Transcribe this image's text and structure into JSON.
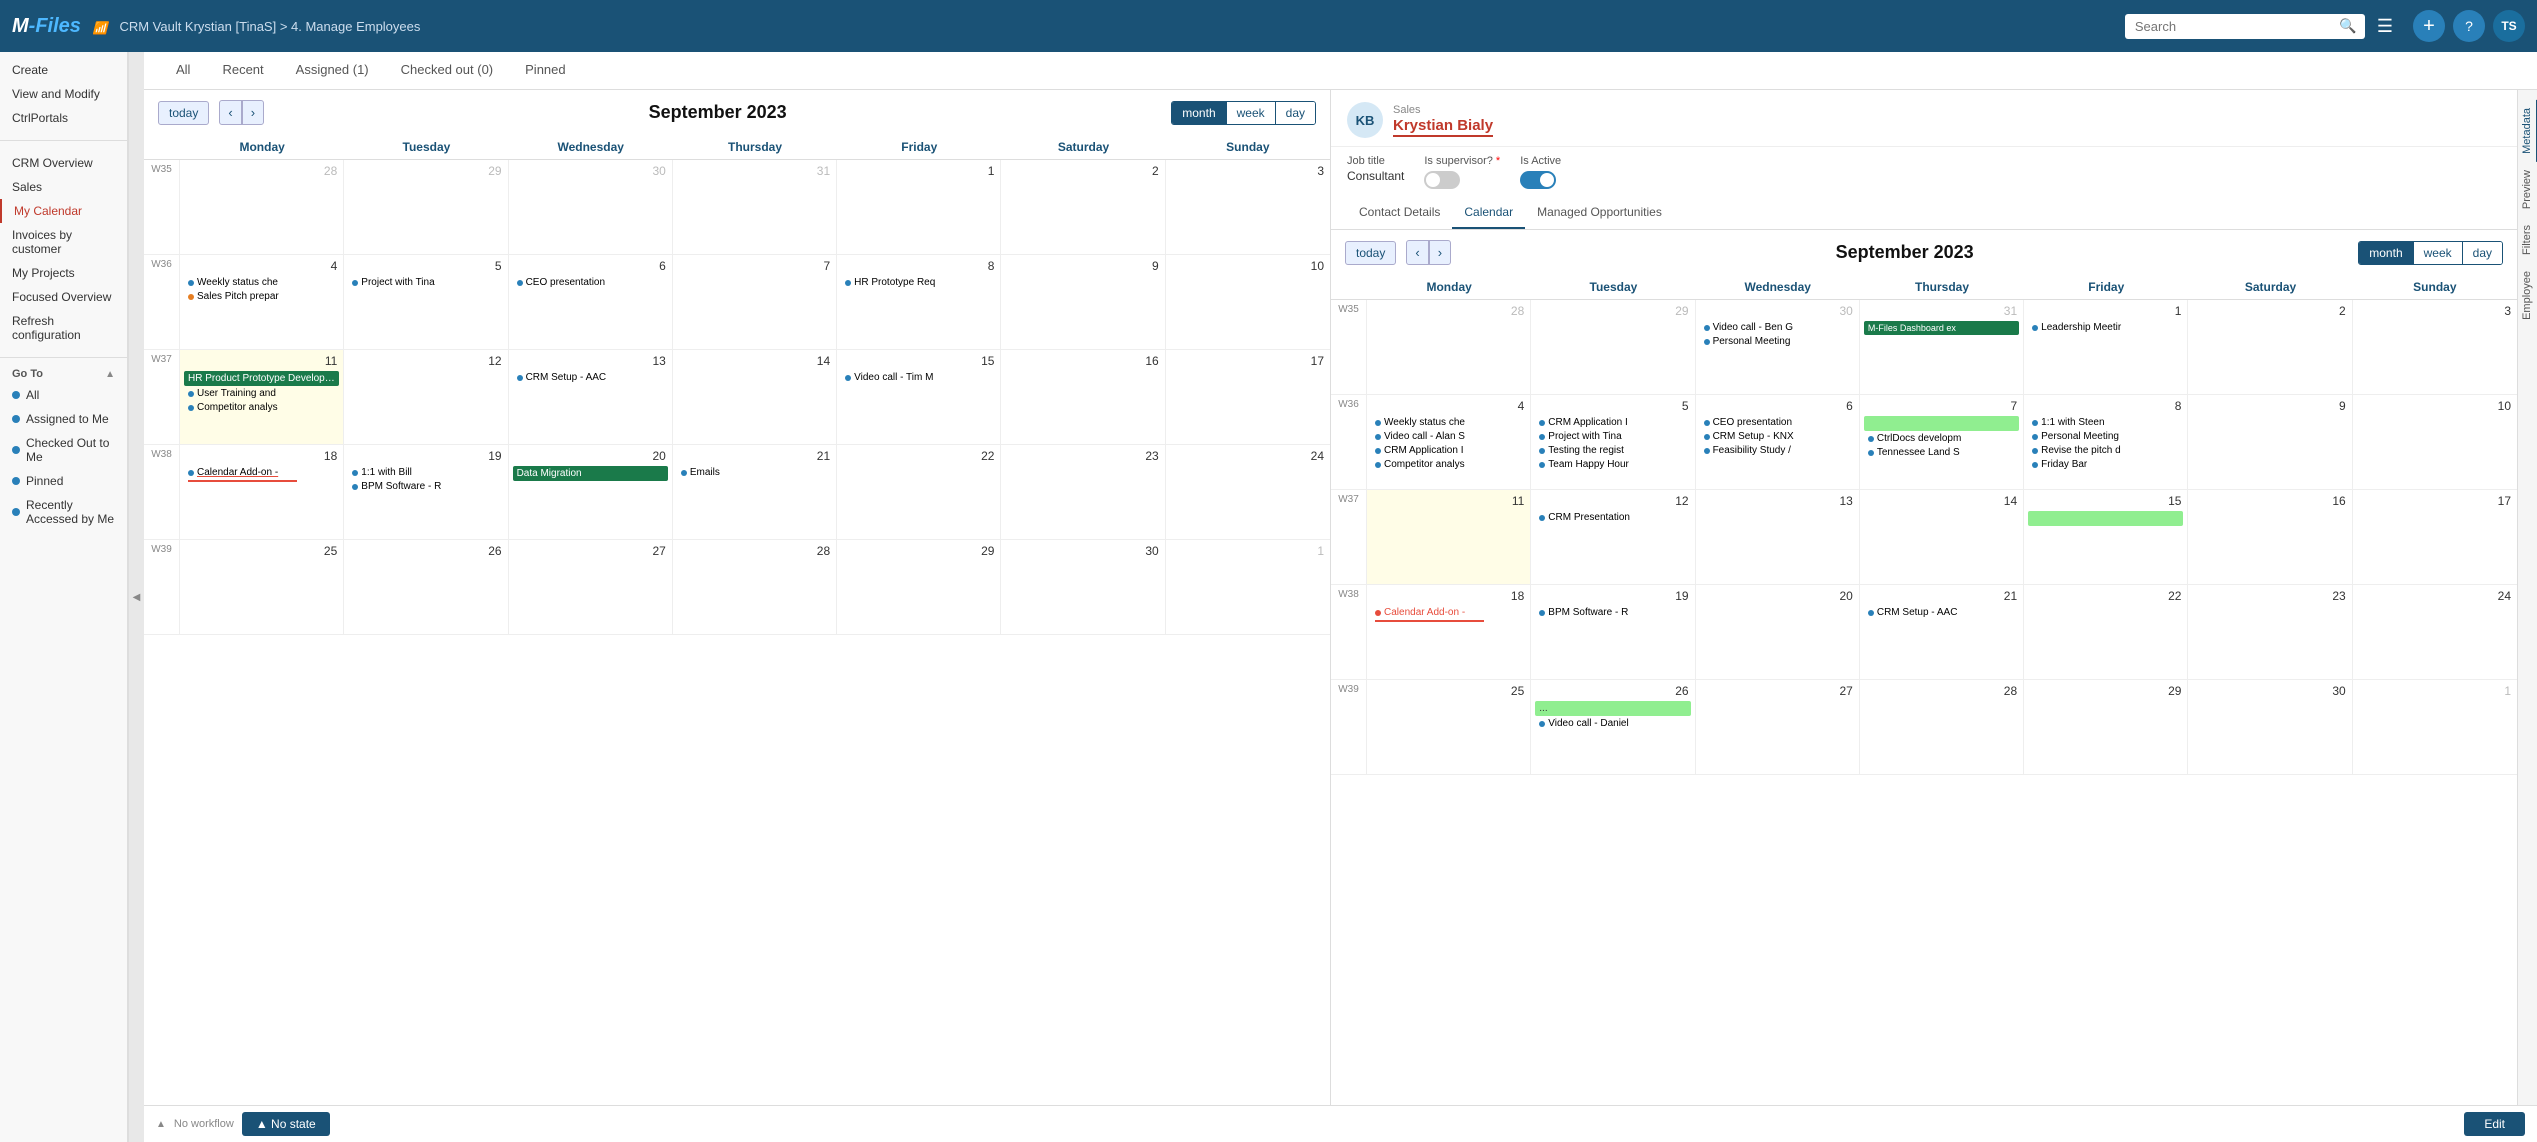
{
  "topbar": {
    "logo": "M-Files",
    "wifi_icon": "📶",
    "breadcrumb": "CRM Vault Krystian [TinaS] > 4. Manage Employees",
    "search_placeholder": "Search",
    "plus_label": "+",
    "help_label": "?",
    "user_label": "TS"
  },
  "sidebar": {
    "top_items": [
      {
        "id": "create",
        "label": "Create"
      },
      {
        "id": "view-modify",
        "label": "View and Modify"
      },
      {
        "id": "ctrlportals",
        "label": "CtrlPortals"
      }
    ],
    "portal_items": [
      {
        "id": "crm-overview",
        "label": "CRM Overview"
      },
      {
        "id": "sales",
        "label": "Sales"
      },
      {
        "id": "my-calendar",
        "label": "My Calendar",
        "active": true
      },
      {
        "id": "invoices",
        "label": "Invoices by customer"
      },
      {
        "id": "my-projects",
        "label": "My Projects"
      },
      {
        "id": "focused-overview",
        "label": "Focused Overview"
      },
      {
        "id": "refresh-config",
        "label": "Refresh configuration"
      }
    ],
    "goto_label": "Go To",
    "goto_items": [
      {
        "id": "all",
        "label": "All",
        "color": "#2980b9",
        "icon": "grid"
      },
      {
        "id": "assigned-to-me",
        "label": "Assigned to Me",
        "color": "#2980b9",
        "icon": "dot"
      },
      {
        "id": "checked-out",
        "label": "Checked Out to Me",
        "color": "#2980b9",
        "icon": "dot"
      },
      {
        "id": "pinned",
        "label": "Pinned",
        "color": "#2980b9",
        "icon": "dot"
      },
      {
        "id": "recently-accessed",
        "label": "Recently Accessed by Me",
        "color": "#2980b9",
        "icon": "dot"
      }
    ]
  },
  "tabs": [
    {
      "id": "all",
      "label": "All",
      "active": false
    },
    {
      "id": "recent",
      "label": "Recent",
      "active": false
    },
    {
      "id": "assigned",
      "label": "Assigned (1)",
      "active": false
    },
    {
      "id": "checked-out",
      "label": "Checked out (0)",
      "active": false
    },
    {
      "id": "pinned",
      "label": "Pinned",
      "active": false
    }
  ],
  "left_calendar": {
    "title": "September 2023",
    "today_btn": "today",
    "view_btns": [
      "month",
      "week",
      "day"
    ],
    "active_view": "month",
    "day_headers": [
      "Monday",
      "Tuesday",
      "Wednesday",
      "Thursday",
      "Friday",
      "Saturday",
      "Sunday"
    ],
    "weeks": [
      {
        "week_num": "W35",
        "days": [
          {
            "date": "28",
            "other": true,
            "events": []
          },
          {
            "date": "29",
            "other": true,
            "events": []
          },
          {
            "date": "30",
            "other": true,
            "events": []
          },
          {
            "date": "31",
            "other": true,
            "events": []
          },
          {
            "date": "1",
            "other": false,
            "events": []
          },
          {
            "date": "2",
            "other": false,
            "events": []
          },
          {
            "date": "3",
            "other": false,
            "events": []
          }
        ]
      },
      {
        "week_num": "W36",
        "days": [
          {
            "date": "4",
            "other": false,
            "events": [
              {
                "text": "Weekly status che",
                "color": "#2980b9",
                "type": "dot"
              },
              {
                "text": "Sales Pitch prepar",
                "color": "#e67e22",
                "type": "dot"
              }
            ]
          },
          {
            "date": "5",
            "other": false,
            "events": [
              {
                "text": "Project with Tina",
                "color": "#2980b9",
                "type": "dot"
              }
            ]
          },
          {
            "date": "6",
            "other": false,
            "events": [
              {
                "text": "CEO presentation",
                "color": "#2980b9",
                "type": "dot"
              }
            ]
          },
          {
            "date": "7",
            "other": false,
            "events": []
          },
          {
            "date": "8",
            "other": false,
            "events": [
              {
                "text": "HR Prototype Req",
                "color": "#2980b9",
                "type": "dot"
              }
            ]
          },
          {
            "date": "9",
            "other": false,
            "events": []
          },
          {
            "date": "10",
            "other": false,
            "events": []
          }
        ]
      },
      {
        "week_num": "W37",
        "days": [
          {
            "date": "11",
            "other": false,
            "today": true,
            "events": [
              {
                "text": "HR Product Prototype Development",
                "color": "#1a7a4a",
                "type": "block"
              },
              {
                "text": "User Training and",
                "color": "#2980b9",
                "type": "dot"
              },
              {
                "text": "Competitor analys",
                "color": "#2980b9",
                "type": "dot"
              }
            ]
          },
          {
            "date": "12",
            "other": false,
            "events": []
          },
          {
            "date": "13",
            "other": false,
            "events": [
              {
                "text": "CRM Setup - AAC",
                "color": "#2980b9",
                "type": "dot"
              }
            ]
          },
          {
            "date": "14",
            "other": false,
            "events": []
          },
          {
            "date": "15",
            "other": false,
            "events": [
              {
                "text": "Video call - Tim M",
                "color": "#2980b9",
                "type": "dot"
              }
            ]
          },
          {
            "date": "16",
            "other": false,
            "events": []
          },
          {
            "date": "17",
            "other": false,
            "events": []
          }
        ]
      },
      {
        "week_num": "W38",
        "days": [
          {
            "date": "18",
            "other": false,
            "events": [
              {
                "text": "Calendar Add-on -",
                "color": "#2980b9",
                "type": "dot",
                "underline": true
              }
            ]
          },
          {
            "date": "19",
            "other": false,
            "events": [
              {
                "text": "1:1 with Bill",
                "color": "#2980b9",
                "type": "dot"
              },
              {
                "text": "BPM Software - R",
                "color": "#2980b9",
                "type": "dot"
              }
            ]
          },
          {
            "date": "20",
            "other": false,
            "events": [
              {
                "text": "Data Migration",
                "color": "#1a7a4a",
                "type": "block"
              }
            ]
          },
          {
            "date": "21",
            "other": false,
            "events": [
              {
                "text": "Emails",
                "color": "#2980b9",
                "type": "dot"
              }
            ]
          },
          {
            "date": "22",
            "other": false,
            "events": []
          },
          {
            "date": "23",
            "other": false,
            "events": []
          },
          {
            "date": "24",
            "other": false,
            "events": []
          }
        ]
      },
      {
        "week_num": "W39",
        "days": [
          {
            "date": "25",
            "other": false,
            "events": []
          },
          {
            "date": "26",
            "other": false,
            "events": []
          },
          {
            "date": "27",
            "other": false,
            "events": []
          },
          {
            "date": "28",
            "other": false,
            "events": []
          },
          {
            "date": "29",
            "other": false,
            "events": []
          },
          {
            "date": "30",
            "other": false,
            "events": []
          },
          {
            "date": "1",
            "other": true,
            "events": []
          }
        ]
      }
    ]
  },
  "right_user": {
    "avatar_initials": "KB",
    "role_label": "Sales",
    "name": "Krystian Bialy",
    "job_title_label": "Job title",
    "job_title_value": "Consultant",
    "is_supervisor_label": "Is supervisor?",
    "is_active_label": "Is Active",
    "is_supervisor": false,
    "is_active": true
  },
  "right_tabs": [
    {
      "id": "contact-details",
      "label": "Contact Details",
      "active": false
    },
    {
      "id": "calendar",
      "label": "Calendar",
      "active": true
    },
    {
      "id": "managed-opps",
      "label": "Managed Opportunities",
      "active": false
    }
  ],
  "right_calendar": {
    "title": "September 2023",
    "today_btn": "today",
    "view_btns": [
      "month",
      "week",
      "day"
    ],
    "active_view": "month",
    "day_headers": [
      "Monday",
      "Tuesday",
      "Wednesday",
      "Thursday",
      "Friday",
      "Saturday",
      "Sunday"
    ],
    "weeks": [
      {
        "week_num": "W35",
        "days": [
          {
            "date": "28",
            "other": true,
            "events": []
          },
          {
            "date": "29",
            "other": true,
            "events": []
          },
          {
            "date": "30",
            "other": true,
            "events": [
              {
                "text": "Video call - Ben G",
                "color": "#2980b9",
                "type": "dot"
              },
              {
                "text": "Personal Meeting",
                "color": "#2980b9",
                "type": "dot"
              }
            ]
          },
          {
            "date": "31",
            "other": true,
            "events": [
              {
                "text": "M-Files Dashboard ex",
                "color": "#1a7a4a",
                "type": "block"
              }
            ]
          },
          {
            "date": "1",
            "other": false,
            "events": [
              {
                "text": "Leadership Meetir",
                "color": "#2980b9",
                "type": "dot"
              }
            ]
          },
          {
            "date": "2",
            "other": false,
            "events": []
          },
          {
            "date": "3",
            "other": false,
            "events": []
          }
        ]
      },
      {
        "week_num": "W36",
        "days": [
          {
            "date": "4",
            "other": false,
            "events": [
              {
                "text": "Weekly status che",
                "color": "#2980b9",
                "type": "dot"
              },
              {
                "text": "Video call - Alan S",
                "color": "#2980b9",
                "type": "dot"
              },
              {
                "text": "CRM Application I",
                "color": "#2980b9",
                "type": "dot"
              },
              {
                "text": "Competitor analys",
                "color": "#2980b9",
                "type": "dot"
              }
            ]
          },
          {
            "date": "5",
            "other": false,
            "events": [
              {
                "text": "CRM Application I",
                "color": "#2980b9",
                "type": "dot"
              },
              {
                "text": "Project with Tina",
                "color": "#2980b9",
                "type": "dot"
              },
              {
                "text": "Testing the regist",
                "color": "#2980b9",
                "type": "dot"
              },
              {
                "text": "Team Happy Hour",
                "color": "#2980b9",
                "type": "dot"
              }
            ]
          },
          {
            "date": "6",
            "other": false,
            "events": [
              {
                "text": "CEO presentation",
                "color": "#2980b9",
                "type": "dot"
              },
              {
                "text": "CRM Setup - KNX",
                "color": "#2980b9",
                "type": "dot"
              },
              {
                "text": "Feasibility Study /",
                "color": "#2980b9",
                "type": "dot"
              }
            ]
          },
          {
            "date": "7",
            "other": false,
            "events": [
              {
                "text": "",
                "color": "#90ee90",
                "type": "block",
                "text2": ""
              },
              {
                "text": "CtrlDocs developm",
                "color": "#2980b9",
                "type": "dot"
              },
              {
                "text": "Tennessee Land S+",
                "color": "#2980b9",
                "type": "dot"
              }
            ]
          },
          {
            "date": "8",
            "other": false,
            "events": [
              {
                "text": "1:1 with Steen",
                "color": "#2980b9",
                "type": "dot"
              },
              {
                "text": "Personal Meeting",
                "color": "#2980b9",
                "type": "dot"
              },
              {
                "text": "Revise the pitch d",
                "color": "#2980b9",
                "type": "dot"
              },
              {
                "text": "Friday Bar",
                "color": "#2980b9",
                "type": "dot"
              }
            ]
          },
          {
            "date": "9",
            "other": false,
            "events": []
          },
          {
            "date": "10",
            "other": false,
            "events": []
          }
        ]
      },
      {
        "week_num": "W37",
        "days": [
          {
            "date": "11",
            "other": false,
            "today": true,
            "events": []
          },
          {
            "date": "12",
            "other": false,
            "events": [
              {
                "text": "CRM Presentation",
                "color": "#2980b9",
                "type": "dot"
              }
            ]
          },
          {
            "date": "13",
            "other": false,
            "events": []
          },
          {
            "date": "14",
            "other": false,
            "events": []
          },
          {
            "date": "15",
            "other": false,
            "events": [
              {
                "text": "",
                "color": "#90ee90",
                "type": "block-wide"
              }
            ]
          },
          {
            "date": "16",
            "other": false,
            "events": []
          },
          {
            "date": "17",
            "other": false,
            "events": []
          }
        ]
      },
      {
        "week_num": "W38",
        "days": [
          {
            "date": "18",
            "other": false,
            "events": [
              {
                "text": "Calendar Add-on -",
                "color": "#e74c3c",
                "type": "dot-underline"
              }
            ]
          },
          {
            "date": "19",
            "other": false,
            "events": [
              {
                "text": "BPM Software - R",
                "color": "#2980b9",
                "type": "dot"
              }
            ]
          },
          {
            "date": "20",
            "other": false,
            "events": []
          },
          {
            "date": "21",
            "other": false,
            "events": [
              {
                "text": "CRM Setup - AAC",
                "color": "#2980b9",
                "type": "dot"
              }
            ]
          },
          {
            "date": "22",
            "other": false,
            "events": []
          },
          {
            "date": "23",
            "other": false,
            "events": []
          },
          {
            "date": "24",
            "other": false,
            "events": []
          }
        ]
      },
      {
        "week_num": "W39",
        "days": [
          {
            "date": "25",
            "other": false,
            "events": []
          },
          {
            "date": "26",
            "other": false,
            "events": [
              {
                "text": "...",
                "color": "#90ee90",
                "type": "block"
              },
              {
                "text": "Video call - Daniel",
                "color": "#2980b9",
                "type": "dot"
              }
            ]
          },
          {
            "date": "27",
            "other": false,
            "events": []
          },
          {
            "date": "28",
            "other": false,
            "events": []
          },
          {
            "date": "29",
            "other": false,
            "events": []
          },
          {
            "date": "30",
            "other": false,
            "events": []
          },
          {
            "date": "1",
            "other": true,
            "events": []
          }
        ]
      }
    ]
  },
  "meta_tabs": [
    "Metadata",
    "Preview",
    "Filters",
    "Employee"
  ],
  "bottom_bar": {
    "workflow_label": "No workflow",
    "no_state_label": "▲ No state",
    "edit_label": "Edit"
  }
}
